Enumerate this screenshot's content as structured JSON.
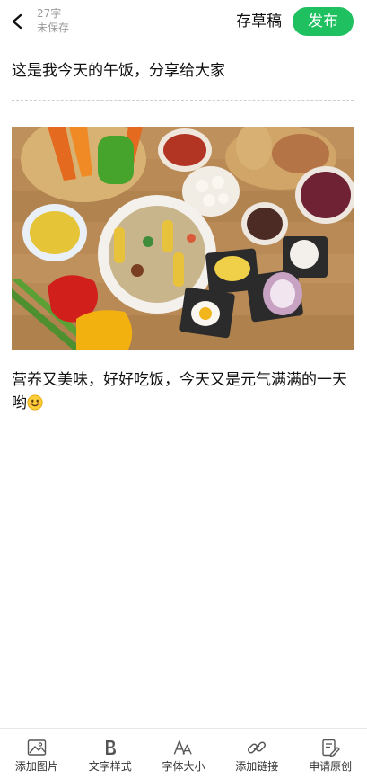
{
  "header": {
    "word_count": "27字",
    "save_status": "未保存",
    "draft_label": "存草稿",
    "publish_label": "发布",
    "publish_color": "#1fc060"
  },
  "article": {
    "title": "这是我今天的午饭，分享给大家",
    "body": "营养又美味，好好吃饭，今天又是元气满满的一天哟",
    "body_emoji": "smiling-face-emoji",
    "image_icon": "food-table-photo"
  },
  "toolbar": {
    "items": [
      {
        "label": "添加图片",
        "icon": "image-icon"
      },
      {
        "label": "文字样式",
        "icon": "bold-b-icon"
      },
      {
        "label": "字体大小",
        "icon": "font-size-icon"
      },
      {
        "label": "添加链接",
        "icon": "link-icon"
      },
      {
        "label": "申请原创",
        "icon": "original-apply-icon"
      }
    ]
  }
}
